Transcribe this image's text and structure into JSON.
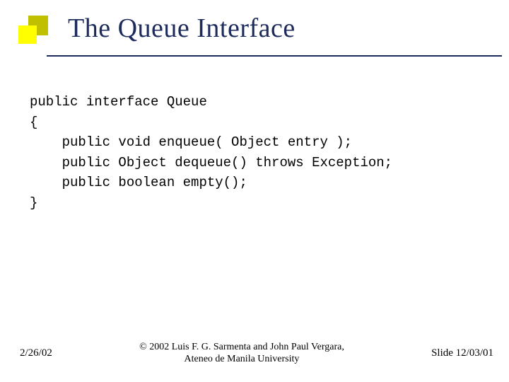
{
  "title": "The Queue Interface",
  "code": {
    "line1": "public interface Queue",
    "line2": "{",
    "line3": "    public void enqueue( Object entry );",
    "line4": "    public Object dequeue() throws Exception;",
    "line5": "    public boolean empty();",
    "line6": "}"
  },
  "footer": {
    "date": "2/26/02",
    "copyright_line1": "© 2002 Luis F. G. Sarmenta and John Paul Vergara,",
    "copyright_line2": "Ateneo de Manila University",
    "slide": "Slide 12/03/01"
  }
}
